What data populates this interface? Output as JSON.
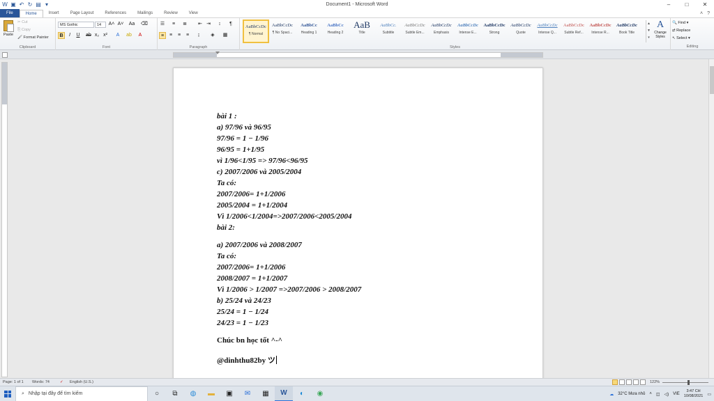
{
  "window": {
    "title": "Document1 - Microsoft Word",
    "controls": {
      "minimize": "–",
      "maximize": "□",
      "close": "✕"
    }
  },
  "qat": {
    "icons": [
      "word-icon",
      "save-icon",
      "undo-icon",
      "redo-icon",
      "print-preview-icon",
      "customize-icon"
    ]
  },
  "tabs": [
    "File",
    "Home",
    "Insert",
    "Page Layout",
    "References",
    "Mailings",
    "Review",
    "View"
  ],
  "active_tab": "Home",
  "ribbon": {
    "clipboard": {
      "paste": "Paste",
      "cut": "Cut",
      "copy": "Copy",
      "format_painter": "Format Painter",
      "label": "Clipboard"
    },
    "font": {
      "name": "MS Gothic",
      "size": "14",
      "label": "Font"
    },
    "paragraph": {
      "label": "Paragraph"
    },
    "styles": {
      "label": "Styles",
      "items": [
        {
          "preview": "AaBbCcDc",
          "name": "¶ Normal"
        },
        {
          "preview": "AaBbCcDc",
          "name": "¶ No Spaci..."
        },
        {
          "preview": "AaBbCc",
          "name": "Heading 1"
        },
        {
          "preview": "AaBbCc",
          "name": "Heading 2"
        },
        {
          "preview": "AaB",
          "name": "Title"
        },
        {
          "preview": "AaBbCc.",
          "name": "Subtitle"
        },
        {
          "preview": "AaBbCcDc",
          "name": "Subtle Em..."
        },
        {
          "preview": "AaBbCcDc",
          "name": "Emphasis"
        },
        {
          "preview": "AaBbCcDc",
          "name": "Intense E..."
        },
        {
          "preview": "AaBbCcDc",
          "name": "Strong"
        },
        {
          "preview": "AaBbCcDc",
          "name": "Quote"
        },
        {
          "preview": "AaBbCcDc",
          "name": "Intense Q..."
        },
        {
          "preview": "AaBbCcDc",
          "name": "Subtle Ref..."
        },
        {
          "preview": "AaBbCcDc",
          "name": "Intense R..."
        },
        {
          "preview": "AaBbCcDc",
          "name": "Book Title"
        }
      ],
      "change_styles": "Change Styles"
    },
    "editing": {
      "find": "Find",
      "replace": "Replace",
      "select": "Select",
      "label": "Editing"
    }
  },
  "document": {
    "lines": [
      "bài 1 :",
      "a) 97/96 và 96/95",
      "97/96 = 1 − 1/96",
      "96/95 = 1+1/95",
      "vì 1/96<1/95 => 97/96<96/95",
      "c) 2007/2006 và 2005/2004",
      "Ta có:",
      "2007/2006= 1+1/2006",
      "2005/2004 = 1+1/2004",
      "Vì 1/2006<1/2004=>2007/2006<2005/2004",
      "bài 2:",
      "a) 2007/2006 và 2008/2007",
      "Ta có:",
      "2007/2006= 1+1/2006",
      "2008/2007 = 1+1/2007",
      "Vì 1/2006 > 1/2007  =>2007/2006 > 2008/2007",
      "b) 25/24 và 24/23",
      "25/24 = 1 − 1/24",
      "24/23 = 1 − 1/23",
      "Chúc bn học tốt ^-^",
      "@dinhthu82by ツ"
    ]
  },
  "status": {
    "page": "Page: 1 of 1",
    "words": "Words: 74",
    "language": "English (U.S.)",
    "zoom": "122%"
  },
  "taskbar": {
    "search_placeholder": "Nhập tại đây để tìm kiếm",
    "weather": "32°C  Mưa nhỏ",
    "lang": "VIE",
    "time": "3:47 CH",
    "date": "10/08/2021"
  }
}
